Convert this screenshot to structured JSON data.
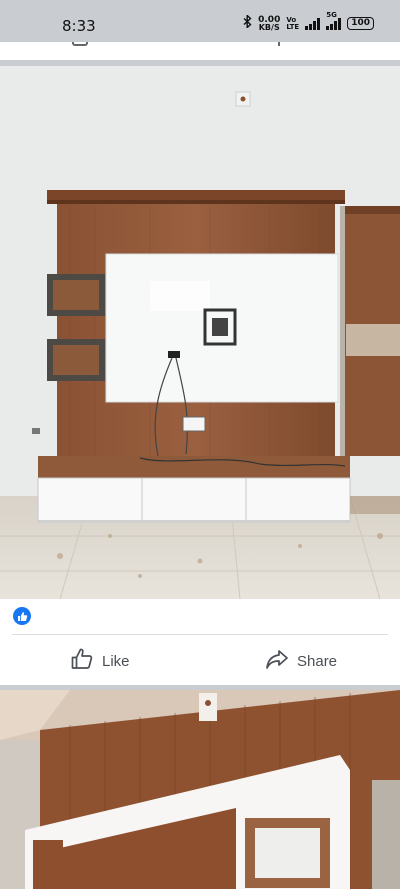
{
  "status_bar": {
    "time": "8:33",
    "data_speed_value": "0.00",
    "data_speed_unit": "KB/S",
    "volte_top": "Vo",
    "volte_bottom": "LTE",
    "network": "5G",
    "battery": "100"
  },
  "post": {
    "reaction_icon": "like-reaction-icon",
    "like_label": "Like",
    "share_label": "Share"
  },
  "colors": {
    "facebook_blue": "#1877f2",
    "action_text": "#4b4f56",
    "feed_gap": "#c9ccd1"
  }
}
